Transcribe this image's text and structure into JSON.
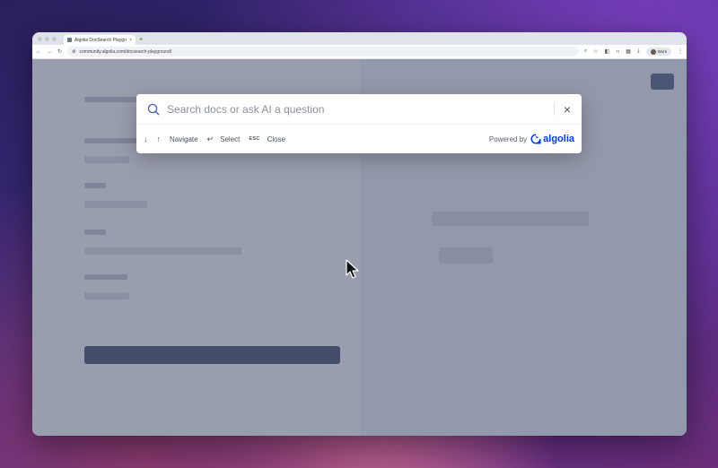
{
  "browser": {
    "tab_title": "Algolia DocSearch Playground",
    "tab_close": "×",
    "new_tab": "+",
    "url": "community.algolia.com/docsearch-playground/",
    "profile_label": "Work"
  },
  "search": {
    "placeholder": "Search docs or ask AI a question",
    "close_label": "×"
  },
  "footer": {
    "navigate_label": "Navigate",
    "select_label": "Select",
    "esc_key": "ESC",
    "close_label": "Close",
    "powered_by": "Powered by",
    "brand": "algolia"
  },
  "colors": {
    "accent": "#003dff",
    "overlay": "#485270"
  }
}
